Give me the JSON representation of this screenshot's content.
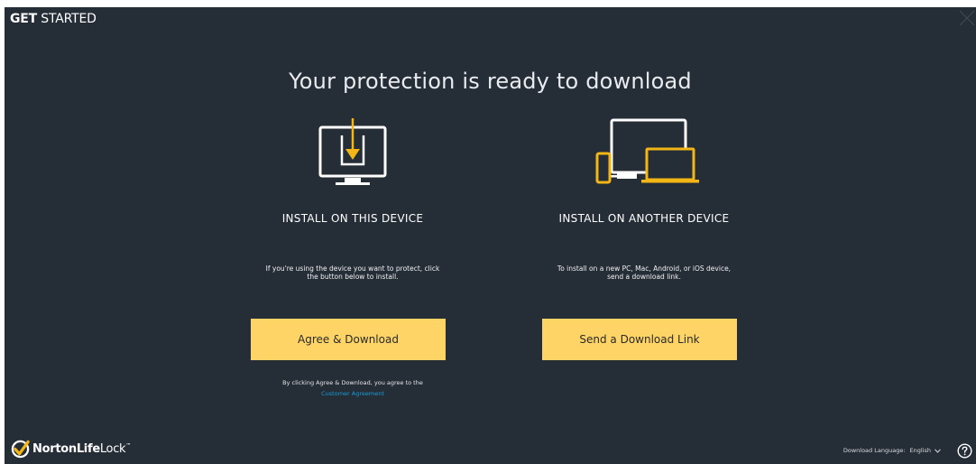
{
  "window": {
    "title_bold": "GET",
    "title_rest": " STARTED"
  },
  "main": {
    "heading": "Your protection is ready to download"
  },
  "this_device": {
    "icon": "monitor-download-icon",
    "heading": "INSTALL ON THIS DEVICE",
    "desc_line1": "If you're using the device you want to protect, click",
    "desc_line2": "the button below to install.",
    "button_label": "Agree & Download",
    "agreement_text": "By clicking Agree & Download, you agree to the",
    "agreement_link": "Customer Agreement"
  },
  "other_device": {
    "icon": "multi-device-icon",
    "heading": "INSTALL ON ANOTHER DEVICE",
    "desc_line1": "To install on a new PC, Mac, Android, or iOS device,",
    "desc_line2": "send a download link.",
    "button_label": "Send a Download Link"
  },
  "footer": {
    "logo_bold": "Norton",
    "logo_mid": "Life",
    "logo_light": "Lock",
    "tm": "™",
    "language_label": "Download Language:",
    "language_value": "English",
    "help_icon": "help-circle-icon"
  },
  "colors": {
    "background": "#252d37",
    "accent": "#fed467",
    "icon_accent": "#f4b616",
    "link": "#1a9cd8"
  }
}
